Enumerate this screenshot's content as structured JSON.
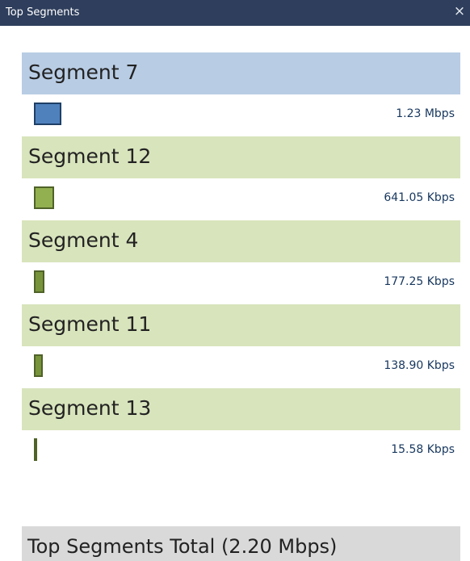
{
  "window": {
    "title": "Top Segments",
    "close_glyph": "×",
    "close_icon": "close-icon"
  },
  "segments": [
    {
      "name": "Segment 7",
      "rate": "1.23 Mbps",
      "highlighted": true,
      "bar_color": "#4f81bd",
      "bar_fraction": 1.0
    },
    {
      "name": "Segment 12",
      "rate": "641.05 Kbps",
      "highlighted": false,
      "bar_color": "#92b050",
      "bar_fraction": 0.52
    },
    {
      "name": "Segment 4",
      "rate": "177.25 Kbps",
      "highlighted": false,
      "bar_color": "#77933c",
      "bar_fraction": 0.144
    },
    {
      "name": "Segment 11",
      "rate": "138.90 Kbps",
      "highlighted": false,
      "bar_color": "#77933c",
      "bar_fraction": 0.113
    },
    {
      "name": "Segment 13",
      "rate": "15.58 Kbps",
      "highlighted": false,
      "bar_color": "#77933c",
      "bar_fraction": 0.0127
    }
  ],
  "total": {
    "label": "Top Segments Total (2.20 Mbps)"
  },
  "colors": {
    "titlebar": "#2e3e5c",
    "highlight_row": "#b8cce4",
    "normal_row": "#d8e4bc",
    "total_row": "#d9d9d9",
    "rate_text": "#17375e"
  }
}
